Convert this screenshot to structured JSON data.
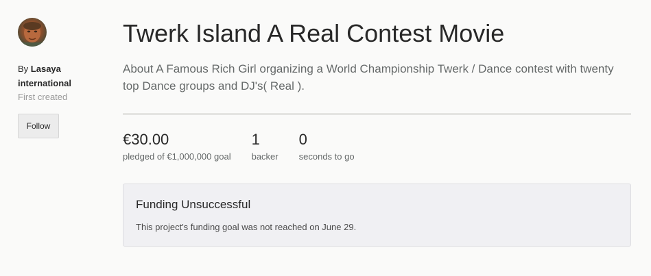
{
  "creator": {
    "by_prefix": "By",
    "name_line1": "Lasaya",
    "name_line2": "international",
    "first_created": "First created",
    "follow_label": "Follow",
    "avatar_icon": "user-avatar-photo"
  },
  "project": {
    "title": "Twerk Island A Real Contest Movie",
    "blurb": "About A Famous Rich Girl organizing a World Championship Twerk / Dance contest with twenty top Dance groups and DJ's( Real )."
  },
  "stats": {
    "pledged_value": "€30.00",
    "pledged_label": "pledged of €1,000,000 goal",
    "backers_value": "1",
    "backers_label": "backer",
    "time_value": "0",
    "time_label": "seconds to go"
  },
  "status": {
    "title": "Funding Unsuccessful",
    "message": "This project's funding goal was not reached on June 29."
  },
  "colors": {
    "background": "#fafaf9",
    "status_box": "#f0f0f3",
    "divider": "#e4e4e2"
  }
}
